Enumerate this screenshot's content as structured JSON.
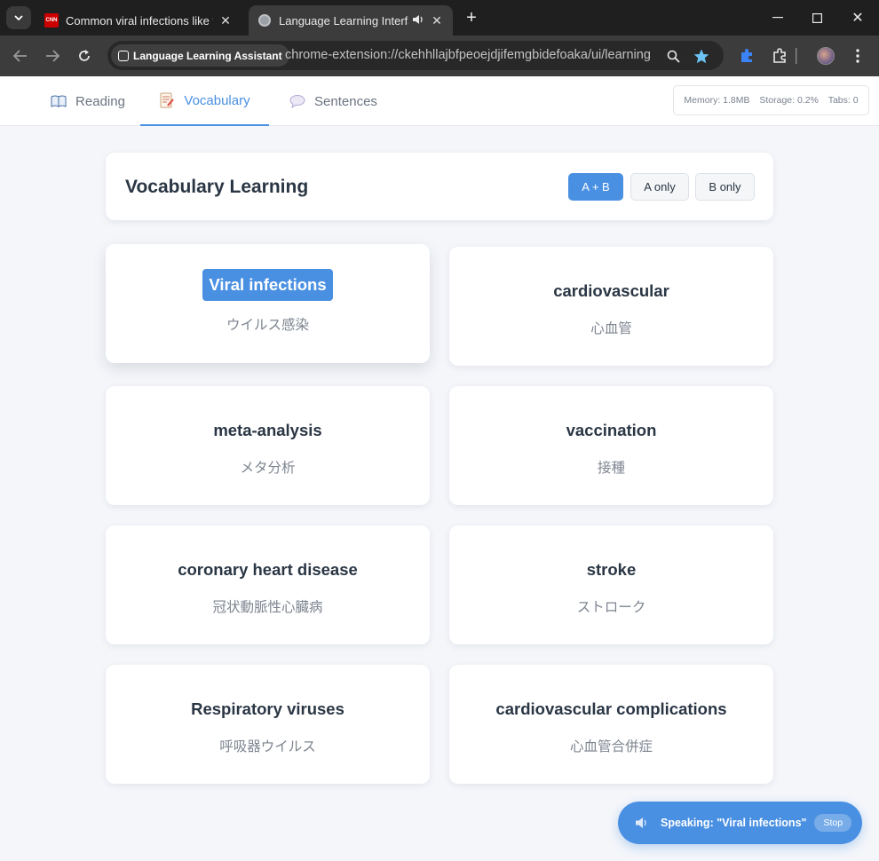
{
  "browser": {
    "tabs": [
      {
        "title": "Common viral infections like flu",
        "favicon": "cnn-favicon",
        "favicon_text": "CNN"
      },
      {
        "title": "Language Learning Interface",
        "favicon": "globe-icon",
        "audio": "speaker-icon"
      }
    ],
    "site_chip": "Language Learning Assistant",
    "url": "chrome-extension://ckehhllajbfpeoejdjifemgbidefoaka/ui/learning"
  },
  "nav": {
    "tabs": [
      {
        "label": "Reading",
        "icon": "book-icon"
      },
      {
        "label": "Vocabulary",
        "icon": "memo-icon"
      },
      {
        "label": "Sentences",
        "icon": "speech-bubble-icon"
      }
    ],
    "active_tab": "Vocabulary",
    "stats": {
      "memory": "Memory: 1.8MB",
      "storage": "Storage: 0.2%",
      "tabs": "Tabs: 0"
    }
  },
  "vocabulary": {
    "title": "Vocabulary Learning",
    "filters": [
      "A + B",
      "A only",
      "B only"
    ],
    "active_filter": "A + B",
    "cards": [
      {
        "term": "Viral infections",
        "translation": "ウイルス感染",
        "highlighted": true
      },
      {
        "term": "cardiovascular",
        "translation": "心血管"
      },
      {
        "term": "meta-analysis",
        "translation": "メタ分析"
      },
      {
        "term": "vaccination",
        "translation": "接種"
      },
      {
        "term": "coronary heart disease",
        "translation": "冠状動脈性心臓病"
      },
      {
        "term": "stroke",
        "translation": "ストローク"
      },
      {
        "term": "Respiratory viruses",
        "translation": "呼吸器ウイルス"
      },
      {
        "term": "cardiovascular complications",
        "translation": "心血管合併症"
      }
    ]
  },
  "speaking": {
    "text": "Speaking: \"Viral infections\"",
    "stop_label": "Stop"
  },
  "colors": {
    "accent": "#4a90e2",
    "page_bg": "#f4f6fa",
    "text_dark": "#2a3644"
  }
}
